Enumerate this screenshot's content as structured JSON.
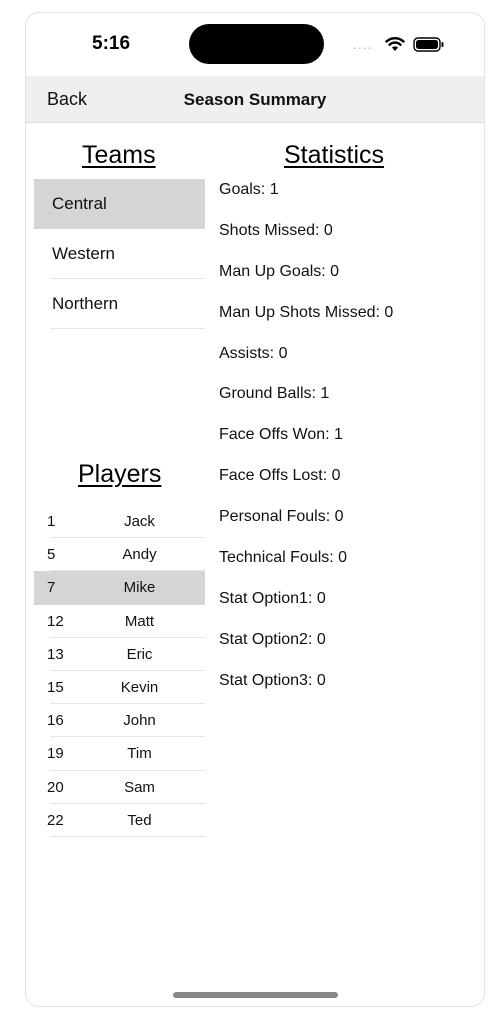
{
  "status": {
    "time": "5:16",
    "signal_dots": "....",
    "wifi_icon": "wifi-icon",
    "battery_icon": "battery-icon"
  },
  "nav": {
    "back_label": "Back",
    "title": "Season Summary"
  },
  "teams": {
    "heading": "Teams",
    "items": [
      {
        "label": "Central",
        "selected": true
      },
      {
        "label": "Western",
        "selected": false
      },
      {
        "label": "Northern",
        "selected": false
      }
    ]
  },
  "players": {
    "heading": "Players",
    "items": [
      {
        "number": "1",
        "name": "Jack",
        "selected": false
      },
      {
        "number": "5",
        "name": "Andy",
        "selected": false
      },
      {
        "number": "7",
        "name": "Mike",
        "selected": true
      },
      {
        "number": "12",
        "name": "Matt",
        "selected": false
      },
      {
        "number": "13",
        "name": "Eric",
        "selected": false
      },
      {
        "number": "15",
        "name": "Kevin",
        "selected": false
      },
      {
        "number": "16",
        "name": "John",
        "selected": false
      },
      {
        "number": "19",
        "name": "Tim",
        "selected": false
      },
      {
        "number": "20",
        "name": "Sam",
        "selected": false
      },
      {
        "number": "22",
        "name": "Ted",
        "selected": false
      }
    ]
  },
  "statistics": {
    "heading": "Statistics",
    "items": [
      "Goals: 1",
      "Shots Missed: 0",
      "Man Up Goals: 0",
      "Man Up Shots Missed: 0",
      "Assists: 0",
      "Ground Balls: 1",
      "Face Offs Won: 1",
      "Face Offs Lost: 0",
      "Personal Fouls: 0",
      "Technical Fouls: 0",
      "Stat Option1: 0",
      "Stat Option2: 0",
      "Stat Option3: 0"
    ]
  },
  "colors": {
    "selected_row": "#d5d5d8",
    "nav_background": "#efefef"
  }
}
